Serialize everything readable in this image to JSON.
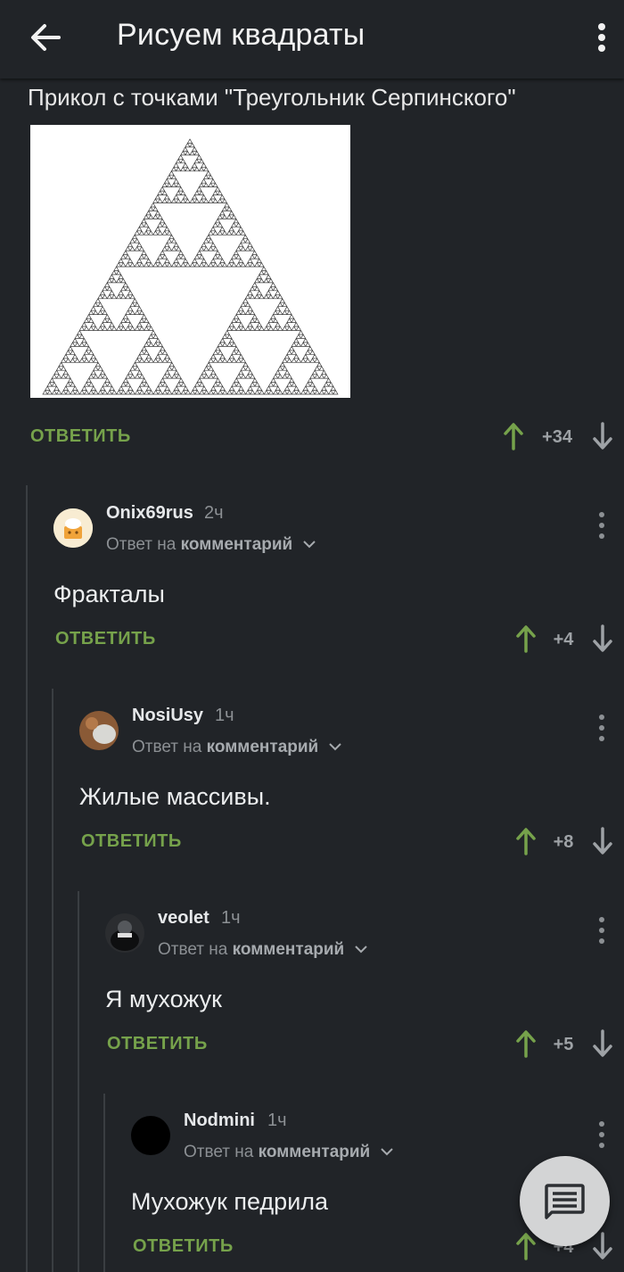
{
  "header": {
    "title": "Рисуем квадраты",
    "back_icon": "arrow-left-icon",
    "menu_icon": "more-vertical-icon"
  },
  "parent_comment": {
    "text": "Прикол с точками \"Треугольник Серпинского\"",
    "image_description": "sierpinski-triangle",
    "reply_label": "ОТВЕТИТЬ",
    "score": "+34"
  },
  "comments": [
    {
      "username": "Onix69rus",
      "time": "2ч",
      "reply_prefix": "Ответ на",
      "reply_target": "комментарий",
      "text": "Фракталы",
      "reply_label": "ОТВЕТИТЬ",
      "score": "+4"
    },
    {
      "username": "NosiUsy",
      "time": "1ч",
      "reply_prefix": "Ответ на",
      "reply_target": "комментарий",
      "text": "Жилые массивы.",
      "reply_label": "ОТВЕТИТЬ",
      "score": "+8"
    },
    {
      "username": "veolet",
      "time": "1ч",
      "reply_prefix": "Ответ на",
      "reply_target": "комментарий",
      "text": "Я мухожук",
      "reply_label": "ОТВЕТИТЬ",
      "score": "+5"
    },
    {
      "username": "Nodmini",
      "time": "1ч",
      "reply_prefix": "Ответ на",
      "reply_target": "комментарий",
      "text": "Мухожук педрила",
      "reply_label": "ОТВЕТИТЬ",
      "score": "+4"
    }
  ],
  "fab": {
    "icon": "comment-icon"
  },
  "colors": {
    "background": "#212428",
    "accent_green": "#76a24b",
    "text_secondary": "#8c9094"
  }
}
